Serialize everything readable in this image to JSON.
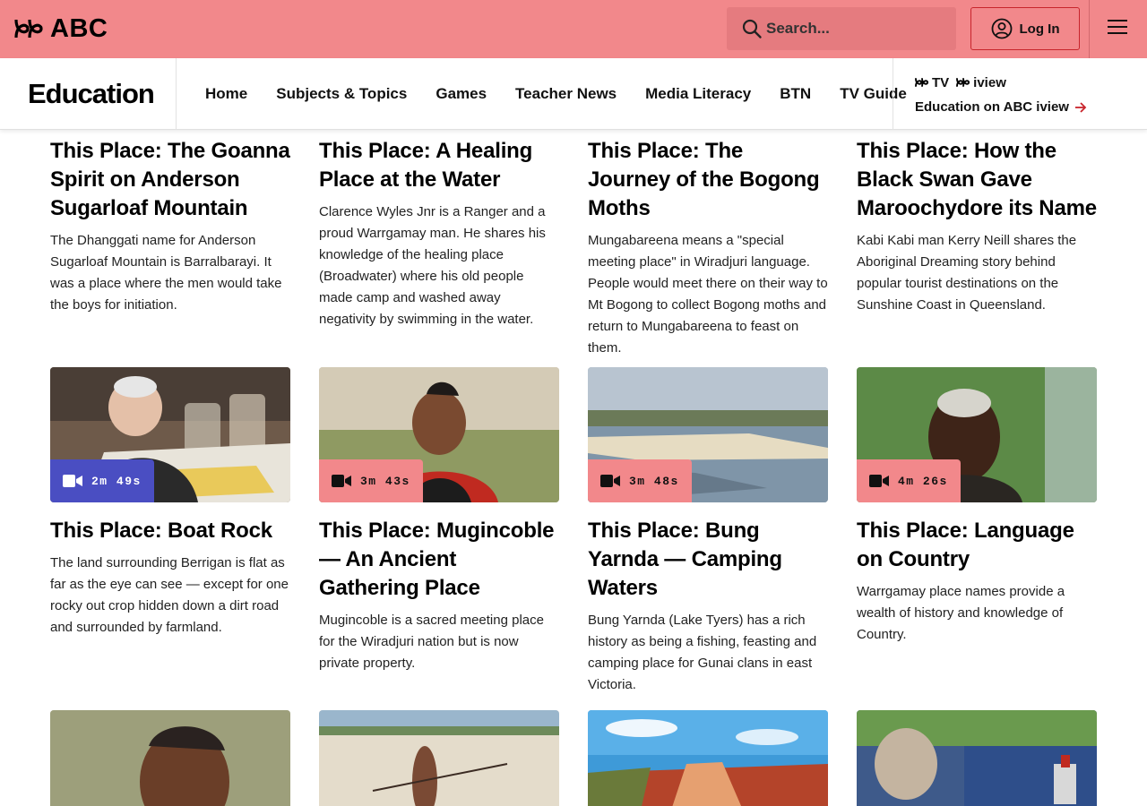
{
  "header": {
    "brand": "ABC",
    "search_placeholder": "Search...",
    "login_label": "Log In"
  },
  "nav": {
    "section_title": "Education",
    "links": [
      "Home",
      "Subjects & Topics",
      "Games",
      "Teacher News",
      "Media Literacy",
      "BTN",
      "TV Guide"
    ],
    "promo_logo_tv": "TV",
    "promo_logo_iview": "iview",
    "promo_link": "Education on ABC iview"
  },
  "cards_row1": [
    {
      "title": "This Place: The Goanna Spirit on Anderson Sugarloaf Mountain",
      "description": "The Dhanggati name for Anderson Sugarloaf Mountain is Barralbarayi. It was a place where the men would take the boys for initiation."
    },
    {
      "title": "This Place: A Healing Place at the Water",
      "description": "Clarence Wyles Jnr is a Ranger and a proud Warrgamay man. He shares his knowledge of the healing place (Broadwater) where his old people made camp and washed away negativity by swimming in the water."
    },
    {
      "title": "This Place: The Journey of the Bogong Moths",
      "description": "Mungabareena means a \"special meeting place\" in Wiradjuri language. People would meet there on their way to Mt Bogong to collect Bogong moths and return to Mungabareena to feast on them."
    },
    {
      "title": "This Place: How the Black Swan Gave Maroochydore its Name",
      "description": "Kabi Kabi man Kerry Neill shares the Aboriginal Dreaming story behind popular tourist destinations on the Sunshine Coast in Queensland."
    }
  ],
  "cards_row2": [
    {
      "duration": "2m 49s",
      "title": "This Place: Boat Rock",
      "description": "The land surrounding Berrigan is flat as far as the eye can see — except for one rocky out crop hidden down a dirt road and surrounded by farmland."
    },
    {
      "duration": "3m 43s",
      "title": "This Place: Mugincoble — An Ancient Gathering Place",
      "description": "Mugincoble is a sacred meeting place for the Wiradjuri nation but is now private property."
    },
    {
      "duration": "3m 48s",
      "title": "This Place: Bung Yarnda — Camping Waters",
      "description": "Bung Yarnda (Lake Tyers) has a rich history as being a fishing, feasting and camping place for Gunai clans in east Victoria."
    },
    {
      "duration": "4m 26s",
      "title": "This Place: Language on Country",
      "description": "Warrgamay place names provide a wealth of history and knowledge of Country."
    }
  ],
  "colors": {
    "header_bg": "#f2888b",
    "badge_active": "#4a4ec2",
    "badge_default": "#f2888b",
    "accent_red": "#c8252c"
  }
}
